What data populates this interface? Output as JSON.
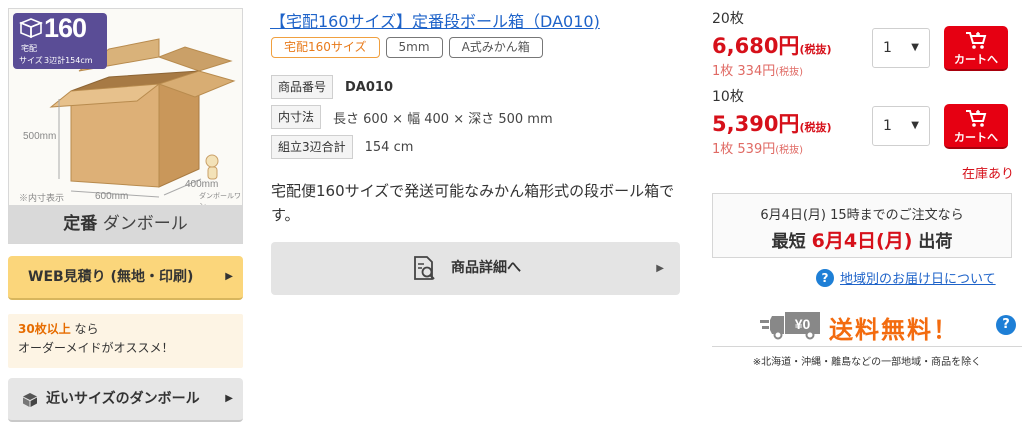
{
  "left": {
    "badge": {
      "number": "160",
      "line1": "宅配",
      "line2": "サイズ",
      "line3": "3辺計154cm"
    },
    "dims": {
      "height": "500mm",
      "width": "600mm",
      "depth": "400mm",
      "inner_note": "※内寸表示",
      "brand": "ダンボールワン"
    },
    "caption_strong": "定番",
    "caption_rest": " ダンボール",
    "web_quote_label": "WEB見積り (無地・印刷)",
    "promo_highlight": "30枚以上",
    "promo_after": " なら",
    "promo_line2": "オーダーメイドがオススメ！",
    "nearby_label": "近いサイズのダンボール"
  },
  "product": {
    "title": "【宅配160サイズ】定番段ボール箱（DA010)",
    "tags": [
      "宅配160サイズ",
      "5mm",
      "A式みかん箱"
    ],
    "specs": [
      {
        "label": "商品番号",
        "value": "DA010"
      },
      {
        "label": "内寸法",
        "value": "長さ 600 × 幅 400 × 深さ 500 mm"
      },
      {
        "label": "組立3辺合計",
        "value": "154 cm"
      }
    ],
    "description": "宅配便160サイズで発送可能なみかん箱形式の段ボール箱です。",
    "detail_button": "商品詳細へ"
  },
  "pricing": [
    {
      "qty": "20枚",
      "price": "6,680円",
      "tax": "(税抜)",
      "unit": "1枚 334円",
      "unit_tax": "(税抜)",
      "select": "1",
      "cart": "カートへ"
    },
    {
      "qty": "10枚",
      "price": "5,390円",
      "tax": "(税抜)",
      "unit": "1枚 539円",
      "unit_tax": "(税抜)",
      "select": "1",
      "cart": "カートへ"
    }
  ],
  "stock": "在庫あり",
  "delivery": {
    "line1": "6月4日(月) 15時までのご注文なら",
    "prefix": "最短 ",
    "date": "6月4日(月)",
    "suffix": " 出荷"
  },
  "region_link": "地域別のお届け日について",
  "free_shipping": {
    "badge": "¥0",
    "title": "送料無料！",
    "note": "※北海道・沖縄・離島などの一部地域・商品を除く"
  },
  "colors": {
    "accent_red": "#d6101a",
    "link_blue": "#1e63c9",
    "badge_purple": "#5a4d96",
    "free_orange": "#f36b0f"
  },
  "icons": [
    "box-icon",
    "doc-search-icon",
    "cart-icon",
    "question-icon",
    "truck-icon",
    "cube-icon",
    "chevron-right-icon",
    "caret-down-icon"
  ]
}
